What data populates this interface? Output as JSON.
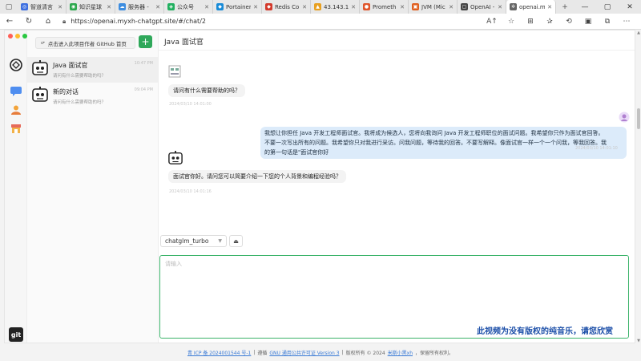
{
  "browser": {
    "tabs": [
      {
        "label": "智道清言",
        "color": "#3d6fe0",
        "glyph": "◎"
      },
      {
        "label": "知识星球",
        "color": "#2ea84f",
        "glyph": "◉"
      },
      {
        "label": "服务器 -",
        "color": "#3d8de0",
        "glyph": "☁"
      },
      {
        "label": "公众号",
        "color": "#22b060",
        "glyph": "◈"
      },
      {
        "label": "Portainer",
        "color": "#1a8cd8",
        "glyph": "◆"
      },
      {
        "label": "Redis Co",
        "color": "#d33a2c",
        "glyph": "◆"
      },
      {
        "label": "43.143.1",
        "color": "#e8a020",
        "glyph": "▲"
      },
      {
        "label": "Prometh",
        "color": "#e0562c",
        "glyph": "●"
      },
      {
        "label": "JVM (Mic",
        "color": "#e06020",
        "glyph": "▣"
      },
      {
        "label": "OpenAI -",
        "color": "#444444",
        "glyph": "▢"
      },
      {
        "label": "openai.m",
        "color": "#666666",
        "glyph": "✲"
      }
    ],
    "url": "https://openai.myxh-chatgpt.site/#/chat/2"
  },
  "sidebar": {
    "github_button": "点击进入此项目作者 GitHub 首页",
    "conversations": [
      {
        "title": "Java 面试官",
        "preview": "请问有什么需要帮助的吗？",
        "time": "10:47 PM"
      },
      {
        "title": "新的对话",
        "preview": "请问有什么需要帮助的吗？",
        "time": "09:04 PM"
      }
    ]
  },
  "chat": {
    "title": "Java 面试官",
    "messages": [
      {
        "role": "bot",
        "text": "请问有什么需要帮助的吗？",
        "time": "2024/03/10 14:01:00"
      },
      {
        "role": "user",
        "lines": [
          "我想让你担任 Java 开发工程师面试官。我将成为候选人，您将向我询问 Java 开发工程师职位的面试问题。我希望你只作为面试官回答。",
          "不要一次写出所有的问题。我希望你只对我进行采访。问我问题，等待我的回答。不要写解释。像面试官一样一个一个问我，等我回答。我",
          "的第一句话是\"面试官你好"
        ],
        "time": "2024/03/10 14:01:10"
      },
      {
        "role": "bot",
        "text": "面试官你好。请问您可以简要介绍一下您的个人背景和编程经验吗？",
        "time": "2024/03/10 14:01:16"
      }
    ]
  },
  "composer": {
    "model": "chatglm_turbo",
    "placeholder": "请输入"
  },
  "subtitle": "此视频为没有版权的纯音乐，请您欣赏",
  "footer": {
    "icp": "青 ICP 备 2024001544 号-1",
    "sep1": "|",
    "license_prefix": "遵循",
    "license": "GNU 通用公共许可证 Version 3",
    "sep2": "|",
    "copyright_prefix": "版权所有 © 2024",
    "author": "米斯小黑xh",
    "copyright_suffix": "，保留所有权利。"
  }
}
